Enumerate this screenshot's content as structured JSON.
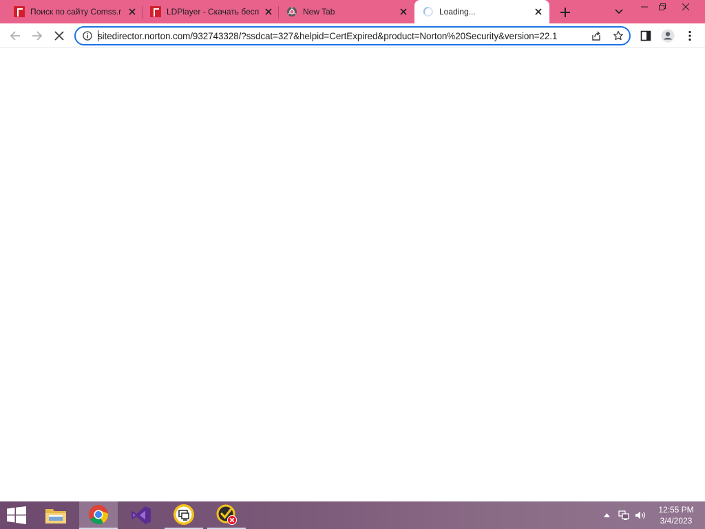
{
  "browser": {
    "tabs": [
      {
        "title": "Поиск по сайту Comss.r",
        "favicon": "comss-icon",
        "active": false
      },
      {
        "title": "LDPlayer - Скачать бесп",
        "favicon": "comss-icon",
        "active": false
      },
      {
        "title": "New Tab",
        "favicon": "chrome-icon",
        "active": false
      },
      {
        "title": "Loading...",
        "favicon": "loading-spinner-icon",
        "active": true
      }
    ],
    "new_tab_icon": "plus-icon",
    "tab_search_icon": "chevron-down-icon",
    "window_controls": [
      "minimize-icon",
      "restore-icon",
      "close-icon"
    ]
  },
  "toolbar": {
    "back_icon": "arrow-left-icon",
    "forward_icon": "arrow-right-icon",
    "stop_icon": "close-icon",
    "url": "sitedirector.norton.com/932743328/?ssdcat=327&helpid=CertExpired&product=Norton%20Security&version=22.1",
    "site_info_icon": "info-icon",
    "share_icon": "share-icon",
    "bookmark_icon": "star-icon",
    "side_panel_icon": "side-panel-icon",
    "profile_icon": "avatar-icon",
    "menu_icon": "kebab-menu-icon"
  },
  "taskbar": {
    "start_icon": "windows-logo-icon",
    "apps": [
      {
        "name": "file-explorer-icon",
        "state": "pinned"
      },
      {
        "name": "chrome-icon",
        "state": "active"
      },
      {
        "name": "visual-studio-icon",
        "state": "pinned"
      },
      {
        "name": "remote-desktop-icon",
        "state": "open"
      },
      {
        "name": "norton-error-icon",
        "state": "open"
      }
    ],
    "tray_icons": [
      "chevron-up-icon",
      "network-icon",
      "volume-icon"
    ],
    "clock": {
      "time": "12:55 PM",
      "date": "3/4/2023"
    }
  },
  "colors": {
    "tabstrip": "#e8628c",
    "omnibox_focus": "#1a73e8",
    "taskbar": "#7a5878"
  }
}
